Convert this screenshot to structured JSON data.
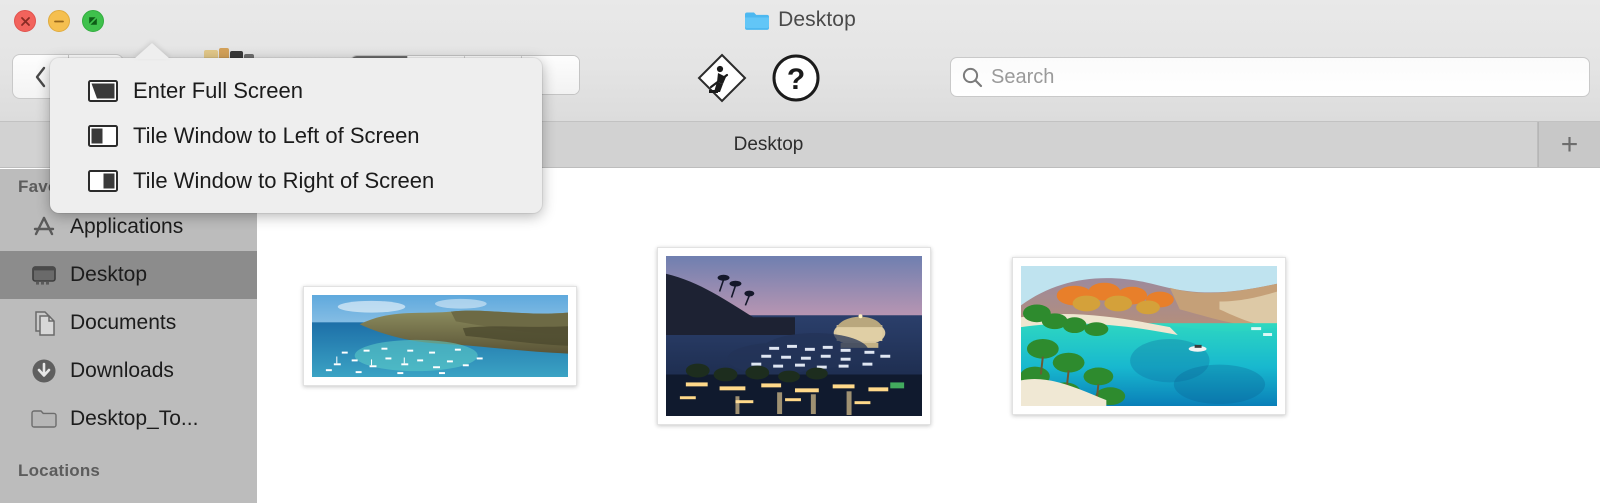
{
  "window": {
    "title": "Desktop",
    "title_icon": "blue-folder-icon",
    "traffic_lights": [
      {
        "name": "close",
        "icon": "close-x-icon",
        "color": "#f2635c"
      },
      {
        "name": "minimize",
        "icon": "minimize-minus-icon",
        "color": "#f5bf4f"
      },
      {
        "name": "maximize",
        "icon": "fullscreen-arrow-icon",
        "color": "#3fc14c"
      }
    ]
  },
  "toolbar": {
    "back_icon": "chevron-left-icon",
    "forward_icon": "chevron-right-icon",
    "view_modes": [
      {
        "name": "icon-view",
        "selected": true
      },
      {
        "name": "list-view",
        "selected": false
      },
      {
        "name": "column-view",
        "selected": false
      },
      {
        "name": "gallery-view",
        "selected": false
      }
    ],
    "action_icon": "construction-sign-icon",
    "help_icon": "question-mark-circle-icon",
    "search": {
      "icon": "search-icon",
      "placeholder": "Search",
      "value": ""
    }
  },
  "tabbar": {
    "tabs": [
      {
        "label": "Desktop",
        "active": true
      }
    ],
    "new_tab_label": "+",
    "new_tab_icon": "plus-icon"
  },
  "sidebar": {
    "sections": [
      {
        "header": "Favorites",
        "items": [
          {
            "label": "Applications",
            "icon": "applications-icon",
            "selected": false
          },
          {
            "label": "Desktop",
            "icon": "desktop-icon",
            "selected": true
          },
          {
            "label": "Documents",
            "icon": "documents-icon",
            "selected": false
          },
          {
            "label": "Downloads",
            "icon": "downloads-icon",
            "selected": false
          },
          {
            "label": "Desktop_To...",
            "icon": "folder-icon",
            "selected": false
          }
        ]
      },
      {
        "header": "Locations",
        "items": []
      }
    ]
  },
  "popover": {
    "items": [
      {
        "label": "Enter Full Screen",
        "icon": "enter-fullscreen-icon"
      },
      {
        "label": "Tile Window to Left of Screen",
        "icon": "tile-left-icon"
      },
      {
        "label": "Tile Window to Right of Screen",
        "icon": "tile-right-icon"
      }
    ]
  },
  "content": {
    "items": [
      {
        "name": "catalina-harbor-panorama",
        "alt": "Panoramic view of Catalina harbor with sailboats and green hills"
      },
      {
        "name": "avalon-harbor-dusk",
        "alt": "Avalon harbor at dusk with casino building and lit waterfront"
      },
      {
        "name": "catalina-turquoise-cove",
        "alt": "Turquoise cove with palm trees and autumn-colored hillside"
      }
    ]
  },
  "colors": {
    "chrome": "#e4e4e4",
    "sidebar": "#bcbcbc",
    "sidebar_selection": "#8c8c8c",
    "tabbar": "#d2d2d2",
    "content": "#ffffff",
    "popover": "#eeeeee",
    "folder_blue": "#4db8f0"
  }
}
